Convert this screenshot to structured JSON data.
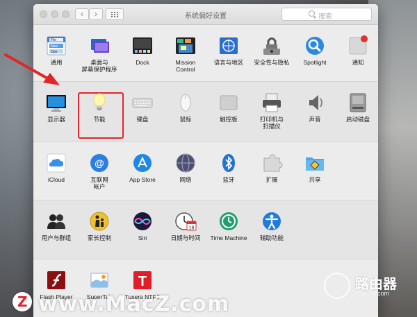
{
  "window": {
    "title": "系统偏好设置"
  },
  "search": {
    "placeholder": "搜索"
  },
  "nav": {
    "back": "‹",
    "forward": "›"
  },
  "sections": [
    [
      {
        "id": "general",
        "label": "通用",
        "icon": "general-icon",
        "badge": [
          "File",
          "New",
          "Ope"
        ]
      },
      {
        "id": "desktop",
        "label": "桌面与",
        "label2": "屏幕保护程序",
        "icon": "desktop-screensaver-icon"
      },
      {
        "id": "dock",
        "label": "Dock",
        "icon": "dock-icon"
      },
      {
        "id": "mission-control",
        "label": "Mission",
        "label2": "Control",
        "icon": "mission-control-icon"
      },
      {
        "id": "language",
        "label": "语言与地区",
        "icon": "language-region-icon"
      },
      {
        "id": "security",
        "label": "安全性与隐私",
        "icon": "security-privacy-icon"
      },
      {
        "id": "spotlight",
        "label": "Spotlight",
        "icon": "spotlight-icon"
      },
      {
        "id": "notifications",
        "label": "通知",
        "icon": "notifications-icon"
      }
    ],
    [
      {
        "id": "displays",
        "label": "显示器",
        "icon": "displays-icon"
      },
      {
        "id": "energy",
        "label": "节能",
        "icon": "energy-saver-icon"
      },
      {
        "id": "keyboard",
        "label": "键盘",
        "icon": "keyboard-icon"
      },
      {
        "id": "mouse",
        "label": "鼠标",
        "icon": "mouse-icon"
      },
      {
        "id": "trackpad",
        "label": "触控板",
        "icon": "trackpad-icon"
      },
      {
        "id": "printers",
        "label": "打印机与",
        "label2": "扫描仪",
        "icon": "printer-icon"
      },
      {
        "id": "sound",
        "label": "声音",
        "icon": "sound-icon"
      },
      {
        "id": "startup",
        "label": "启动磁盘",
        "icon": "startup-disk-icon"
      }
    ],
    [
      {
        "id": "icloud",
        "label": "iCloud",
        "icon": "icloud-icon"
      },
      {
        "id": "internet-accounts",
        "label": "互联网",
        "label2": "帐户",
        "icon": "internet-accounts-icon"
      },
      {
        "id": "app-store",
        "label": "App Store",
        "icon": "app-store-icon"
      },
      {
        "id": "network",
        "label": "网络",
        "icon": "network-icon"
      },
      {
        "id": "bluetooth",
        "label": "蓝牙",
        "icon": "bluetooth-icon"
      },
      {
        "id": "extensions",
        "label": "扩展",
        "icon": "extensions-icon"
      },
      {
        "id": "sharing",
        "label": "共享",
        "icon": "sharing-icon"
      }
    ],
    [
      {
        "id": "users",
        "label": "用户与群组",
        "icon": "users-groups-icon"
      },
      {
        "id": "parental",
        "label": "家长控制",
        "icon": "parental-controls-icon"
      },
      {
        "id": "siri",
        "label": "Siri",
        "icon": "siri-icon"
      },
      {
        "id": "datetime",
        "label": "日期与时间",
        "icon": "date-time-icon",
        "cal": "18"
      },
      {
        "id": "time-machine",
        "label": "Time Machine",
        "icon": "time-machine-icon"
      },
      {
        "id": "accessibility",
        "label": "辅助功能",
        "icon": "accessibility-icon"
      }
    ],
    [
      {
        "id": "flash",
        "label": "Flash Player",
        "icon": "flash-player-icon"
      },
      {
        "id": "supertab",
        "label": "SuperTab",
        "icon": "supertab-icon"
      },
      {
        "id": "tuxera",
        "label": "Tuxera NTFS",
        "icon": "tuxera-ntfs-icon",
        "glyph": "T"
      }
    ]
  ],
  "watermark": {
    "z": "Z",
    "text": "www.MacZ.com"
  },
  "router": {
    "name": "路由器",
    "url": "luyouqi.com"
  }
}
